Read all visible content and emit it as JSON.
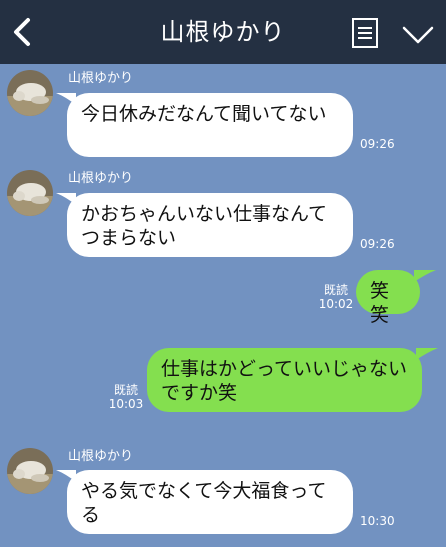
{
  "header": {
    "title": "山根ゆかり",
    "back_icon": "chevron-left-icon",
    "menu_icon": "notes-icon",
    "collapse_icon": "chevron-down-icon"
  },
  "messages": [
    {
      "sender": "山根ゆかり",
      "text": "今日休みだなんて聞いてない",
      "time": "09:26"
    },
    {
      "sender": "山根ゆかり",
      "text": "かおちゃんいない仕事なんてつまらない",
      "time": "09:26"
    },
    {
      "text": "笑笑",
      "read": "既読",
      "time": "10:02"
    },
    {
      "text": "仕事はかどっていいじゃないですか笑",
      "read": "既読",
      "time": "10:03"
    },
    {
      "sender": "山根ゆかり",
      "text": "やる気でなくて今大福食ってる",
      "time": "10:30"
    }
  ],
  "colors": {
    "header": "#243042",
    "background": "#7292c1",
    "incoming_bubble": "#ffffff",
    "outgoing_bubble": "#84df4f"
  }
}
